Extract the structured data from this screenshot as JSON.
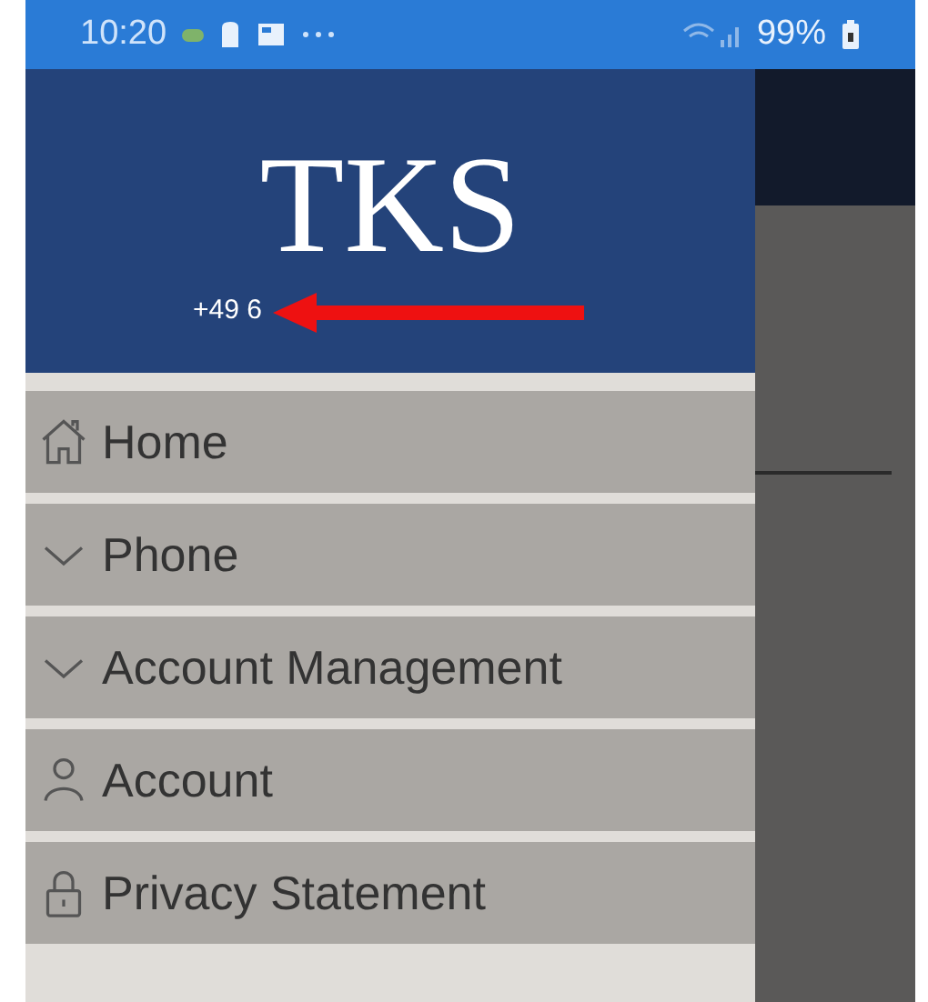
{
  "status_bar": {
    "time": "10:20",
    "battery": "99%"
  },
  "drawer": {
    "header": {
      "title": "TKS",
      "phone": "+49 6"
    },
    "items": [
      {
        "kind": "home",
        "label": "Home"
      },
      {
        "kind": "chevron",
        "label": "Phone"
      },
      {
        "kind": "chevron",
        "label": "Account Management"
      },
      {
        "kind": "person",
        "label": "Account"
      },
      {
        "kind": "lock",
        "label": "Privacy Statement"
      }
    ]
  }
}
